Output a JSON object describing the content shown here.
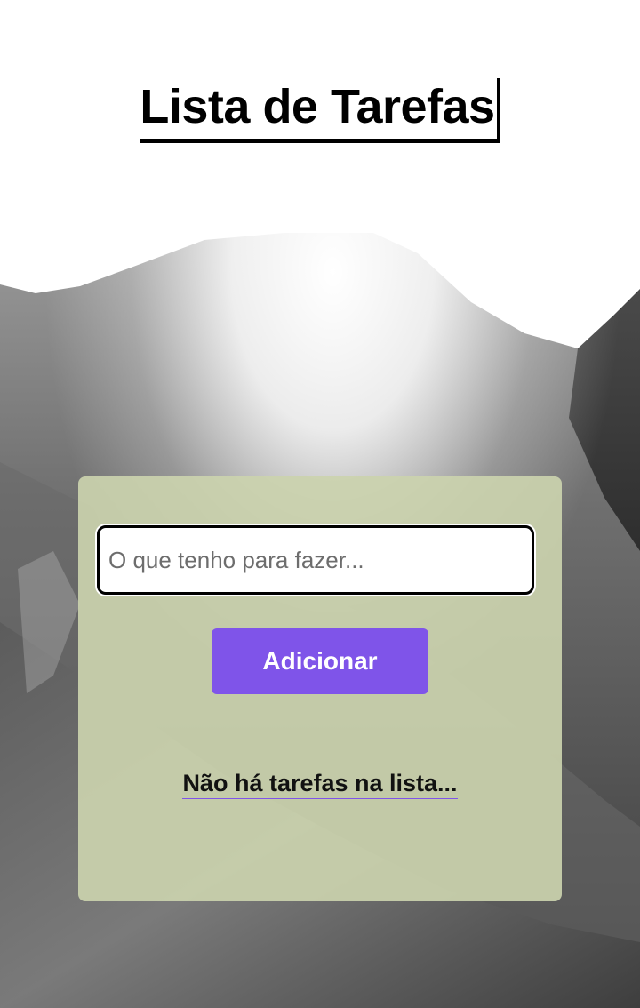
{
  "header": {
    "title": "Lista de Tarefas"
  },
  "todo": {
    "input_value": "",
    "input_placeholder": "O que tenho para fazer...",
    "add_label": "Adicionar",
    "empty_message": "Não há tarefas na lista..."
  },
  "theme": {
    "accent": "#7f54e9",
    "card_bg": "#cbd3ae",
    "title_color": "#000000"
  }
}
